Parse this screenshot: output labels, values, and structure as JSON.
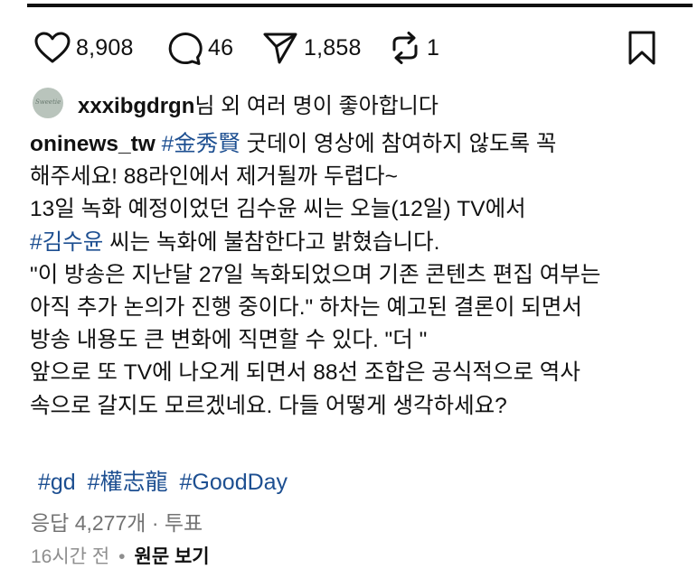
{
  "actions": {
    "likes": "8,908",
    "comments": "46",
    "shares": "1,858",
    "reposts": "1"
  },
  "liked_by": {
    "avatar_text": "Sweetie",
    "username": "xxxibgdrgn",
    "suffix": "님 외 여러 명이 좋아합니다"
  },
  "post": {
    "username": "oninews_tw",
    "hashtag_1": "#金秀賢",
    "line1_rest": "굿데이 영상에 참여하지 않도록 꼭",
    "line2": "해주세요! 88라인에서 제거될까 두렵다~",
    "line3": "13일 녹화 예정이었던 김수윤 씨는 오늘(12일) TV에서",
    "hashtag_2": "#김수윤",
    "line4_rest": "씨는 녹화에 불참한다고 밝혔습니다.",
    "line5": "\"이 방송은 지난달 27일 녹화되었으며 기존 콘텐츠 편집 여부는",
    "line6": "아직 추가 논의가 진행 중이다.\" 하차는 예고된 결론이 되면서",
    "line7": "방송 내용도 큰 변화에 직면할 수 있다. \"더 \"",
    "line8": "앞으로 또 TV에 나오게 되면서 88선 조합은 공식적으로 역사",
    "line9": "속으로 갈지도 모르겠네요. 다들 어떻게 생각하세요?"
  },
  "hashtags": [
    "#gd",
    "#權志龍",
    "#GoodDay"
  ],
  "replies": "응답 4,277개 · 투표",
  "footer": {
    "time": "16시간 전",
    "dot": "•",
    "original": "원문 보기"
  },
  "colors": {
    "hashtag": "#1d4f91",
    "muted": "#737373",
    "text": "#111111"
  }
}
